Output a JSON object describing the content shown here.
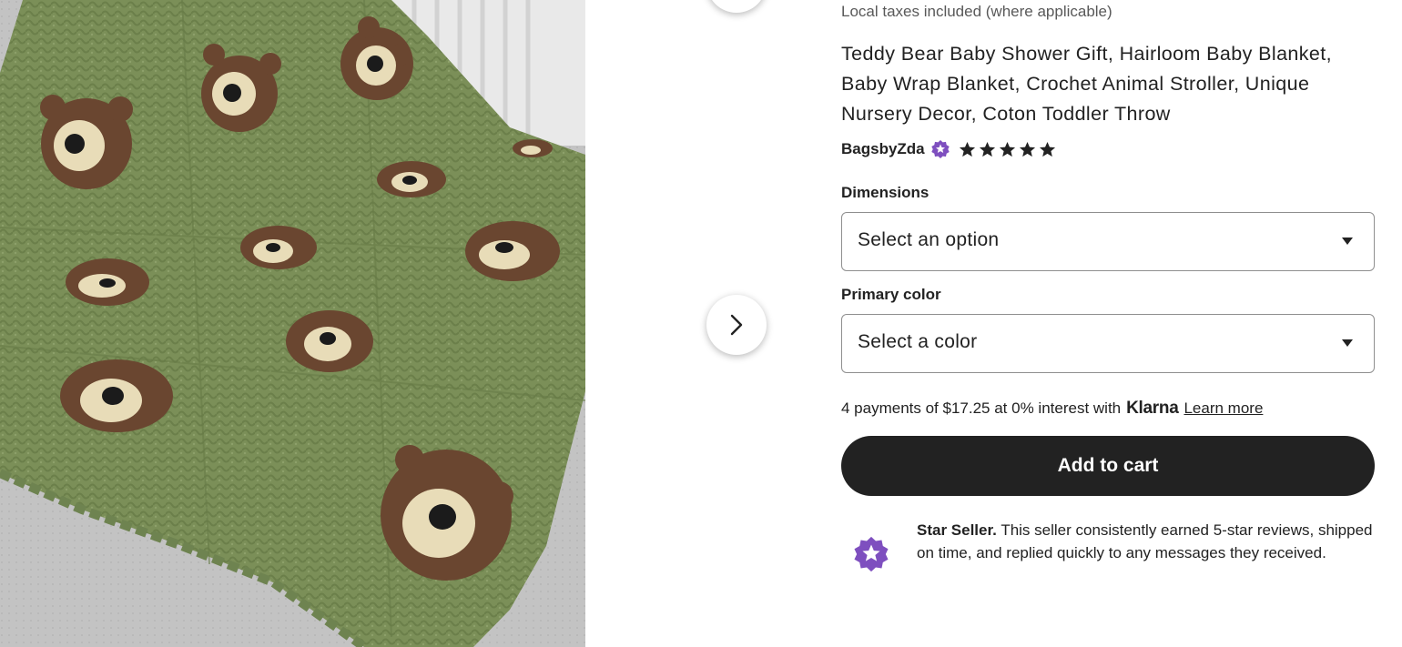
{
  "product_image": {
    "alt": "Olive green crochet blanket with brown teddy bear faces"
  },
  "carousel": {
    "prev_icon": "chevron-icon",
    "next_icon": "chevron-right-icon"
  },
  "listing": {
    "taxes_note": "Local taxes included (where applicable)",
    "title": "Teddy Bear Baby Shower Gift, Hairloom Baby Blanket, Baby Wrap Blanket, Crochet Animal Stroller, Unique Nursery Decor, Coton Toddler Throw",
    "seller": {
      "name": "BagsbyZda",
      "badge_icon": "star-seller-badge-icon",
      "rating": 5,
      "rating_max": 5
    }
  },
  "variations": [
    {
      "label": "Dimensions",
      "selected": "Select an option"
    },
    {
      "label": "Primary color",
      "selected": "Select a color"
    }
  ],
  "payment": {
    "installments_text": "4 payments of $17.25 at 0% interest with",
    "provider": "Klarna",
    "learn_more": "Learn more"
  },
  "cart": {
    "add_to_cart_label": "Add to cart"
  },
  "star_seller": {
    "title": "Star Seller.",
    "description": "This seller consistently earned 5-star reviews, shipped on time, and replied quickly to any messages they received.",
    "icon": "star-seller-icon"
  },
  "colors": {
    "text": "#222222",
    "muted": "#595959",
    "cart_button": "#222222",
    "star_seller_purple": "#7e4fbf"
  }
}
